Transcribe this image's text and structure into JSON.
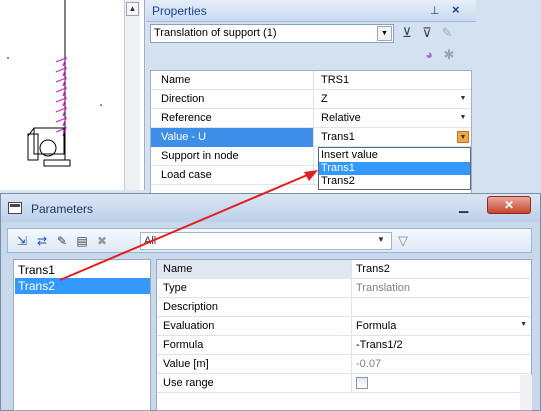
{
  "properties": {
    "title": "Properties",
    "selector": "Translation of support (1)",
    "rows": [
      {
        "name": "Name",
        "value": "TRS1"
      },
      {
        "name": "Direction",
        "value": "Z"
      },
      {
        "name": "Reference",
        "value": "Relative"
      },
      {
        "name": "Value - U",
        "value": "Trans1"
      },
      {
        "name": "Support in node",
        "value": ""
      },
      {
        "name": "Load case",
        "value": ""
      }
    ],
    "dropdown_options": [
      "Insert value",
      "Trans1",
      "Trans2"
    ]
  },
  "parameters": {
    "title": "Parameters",
    "filter_value": "All",
    "list": [
      "Trans1",
      "Trans2"
    ],
    "grid": [
      {
        "name": "Name",
        "value": "Trans2"
      },
      {
        "name": "Type",
        "value": "Translation"
      },
      {
        "name": "Description",
        "value": ""
      },
      {
        "name": "Evaluation",
        "value": "Formula"
      },
      {
        "name": "Formula",
        "value": "-Trans1/2"
      },
      {
        "name": "Value [m]",
        "value": "-0.07"
      },
      {
        "name": "Use range",
        "value": ""
      }
    ]
  },
  "colors": {
    "accent": "#3399ff",
    "selected_row": "#3d8ee6",
    "arrow": "#e02020",
    "support_symbol": "#d020d0"
  },
  "icons": [
    "scroll-up-arrow-icon",
    "pin-icon",
    "close-icon",
    "filter-icon",
    "funnel-icon",
    "chevron-down-icon",
    "window-icon"
  ]
}
